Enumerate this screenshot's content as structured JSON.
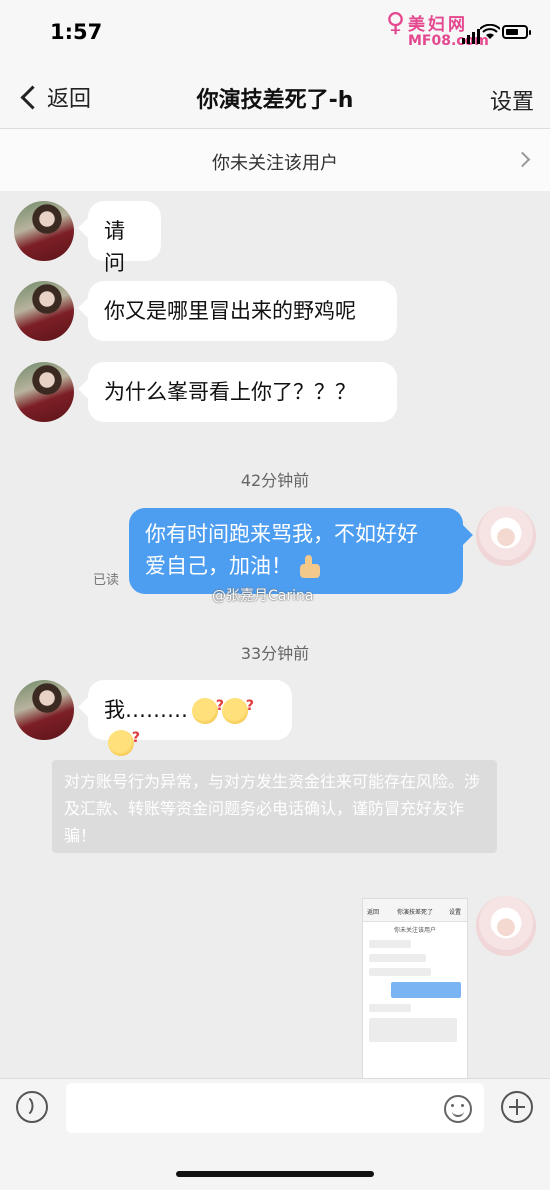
{
  "status_bar": {
    "time": "1:57"
  },
  "watermark": {
    "site_name": "美妇网",
    "site_url": "MF08.com"
  },
  "header": {
    "back_label": "返回",
    "title": "你演技差死了-h",
    "settings_label": "设置"
  },
  "follow_banner": {
    "text": "你未关注该用户"
  },
  "messages": [
    {
      "side": "left",
      "text": "请问"
    },
    {
      "side": "left",
      "text": "你又是哪里冒出来的野鸡呢"
    },
    {
      "side": "left",
      "text": "为什么峯哥看上你了？？？"
    },
    {
      "side": "right",
      "line1": "你有时间跑来骂我，不如好好",
      "line2": "爱自己，加油！",
      "status": "已读"
    },
    {
      "side": "left",
      "text": "我………"
    }
  ],
  "timestamps": [
    "42分钟前",
    "33分钟前"
  ],
  "image_watermark": "@张嘉月Carina",
  "system_notice": "对方账号行为异常，与对方发生资金往来可能存在风险。涉及汇款、转账等资金问题务必电话确认，谨防冒充好友诈骗！",
  "thumbnail": {
    "back": "返回",
    "title": "你演技差死了",
    "settings": "设置",
    "banner": "你未关注该用户"
  },
  "icons": [
    "back-chevron-icon",
    "chevron-right-icon",
    "voice-icon",
    "emoji-icon",
    "plus-icon",
    "thumbs-up-icon",
    "confused-emoji-icon",
    "signal-icon",
    "wifi-icon",
    "battery-icon"
  ],
  "colors": {
    "sent_bubble": "#4d9ef1",
    "received_bubble": "#ffffff",
    "background": "#ededed",
    "watermark": "#e4488f"
  }
}
